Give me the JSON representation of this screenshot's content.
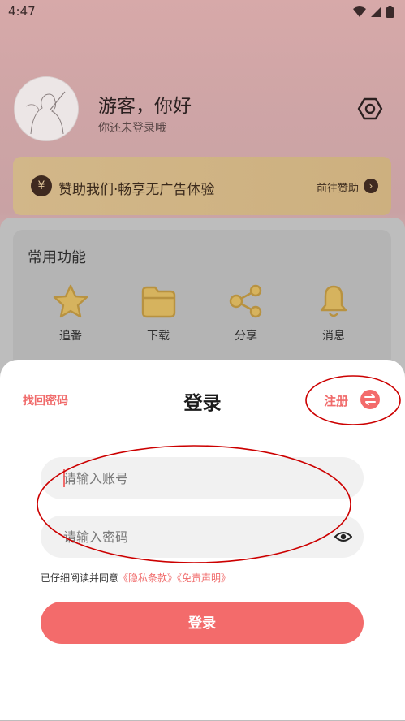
{
  "status_bar": {
    "time": "4:47"
  },
  "profile": {
    "name": "游客，你好",
    "subtitle": "你还未登录哦"
  },
  "sponsor": {
    "text": "赞助我们·畅享无广告体验",
    "link": "前往赞助",
    "coin_symbol": "¥"
  },
  "functions": {
    "title": "常用功能",
    "items": [
      {
        "label": "追番",
        "icon": "star-icon"
      },
      {
        "label": "下载",
        "icon": "folder-icon"
      },
      {
        "label": "分享",
        "icon": "share-icon"
      },
      {
        "label": "消息",
        "icon": "bell-icon"
      }
    ]
  },
  "login_modal": {
    "forgot_password": "找回密码",
    "title": "登录",
    "register": "注册",
    "account_placeholder": "请输入账号",
    "password_placeholder": "请输入密码",
    "agree_prefix": "已仔细阅读并同意",
    "privacy_link": "《隐私条款》",
    "disclaimer_link": "《免责声明》",
    "login_button": "登录"
  },
  "colors": {
    "accent": "#f36b6b",
    "sponsor_gold": "#d2b789",
    "annotation": "#cc0000"
  }
}
